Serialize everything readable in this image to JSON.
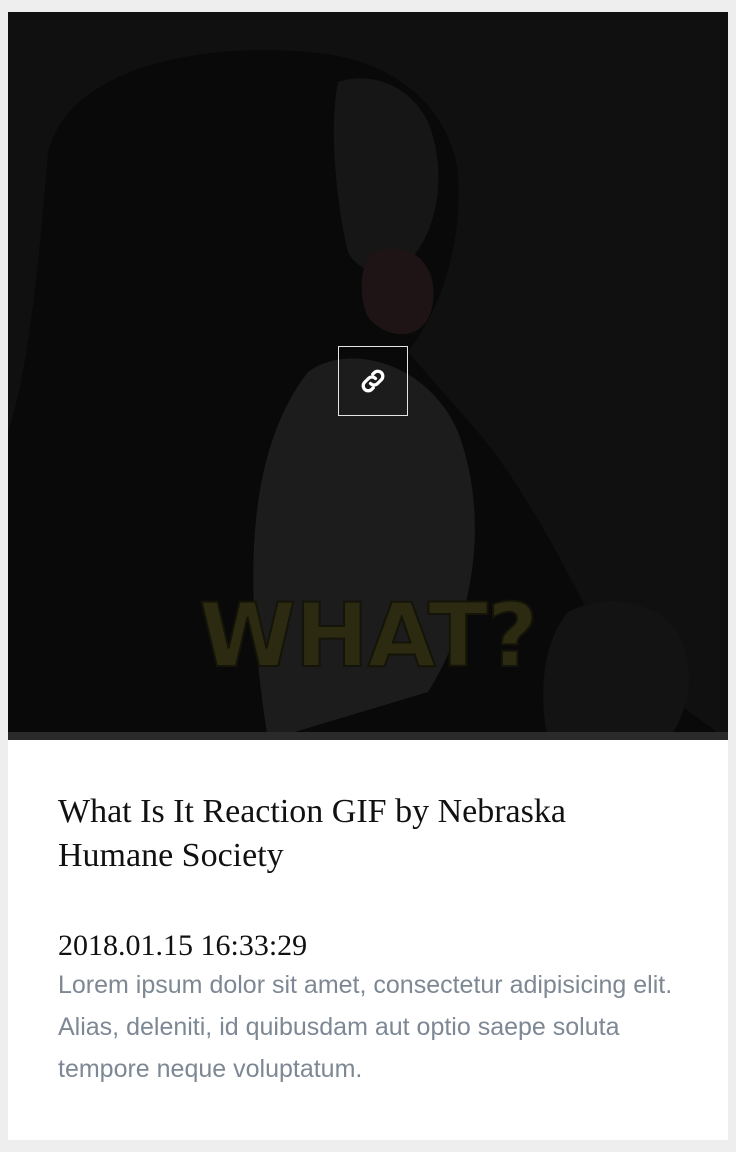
{
  "card": {
    "media": {
      "caption": "WHAT?",
      "link_icon": "link-icon"
    },
    "title": "What Is It Reaction GIF by Nebraska Humane Society",
    "date": "2018.01.15 16:33:29",
    "description": "Lorem ipsum dolor sit amet, consectetur adipisicing elit. Alias, deleniti, id quibusdam aut optio saepe soluta tempore neque voluptatum."
  },
  "colors": {
    "page_background": "#eeeeee",
    "card_background": "#ffffff",
    "description_text": "#7d8894",
    "title_text": "#111111"
  }
}
